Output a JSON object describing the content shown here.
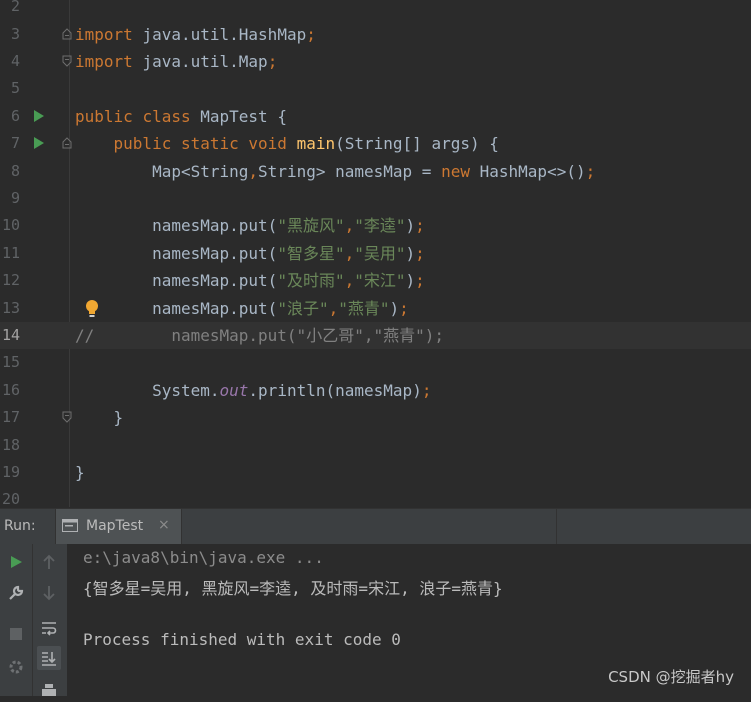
{
  "editor": {
    "lines": [
      {
        "num": "2",
        "code": ""
      },
      {
        "num": "3",
        "code": "import java.util.HashMap;"
      },
      {
        "num": "4",
        "code": "import java.util.Map;"
      },
      {
        "num": "5",
        "code": ""
      },
      {
        "num": "6",
        "code": "public class MapTest {"
      },
      {
        "num": "7",
        "code": "    public static void main(String[] args) {"
      },
      {
        "num": "8",
        "code": "        Map<String,String> namesMap = new HashMap<>();"
      },
      {
        "num": "9",
        "code": ""
      },
      {
        "num": "10",
        "code": "        namesMap.put(\"黑旋风\",\"李逵\");"
      },
      {
        "num": "11",
        "code": "        namesMap.put(\"智多星\",\"吴用\");"
      },
      {
        "num": "12",
        "code": "        namesMap.put(\"及时雨\",\"宋江\");"
      },
      {
        "num": "13",
        "code": "        namesMap.put(\"浪子\",\"燕青\");"
      },
      {
        "num": "14",
        "code": "//        namesMap.put(\"小乙哥\",\"燕青\");"
      },
      {
        "num": "15",
        "code": ""
      },
      {
        "num": "16",
        "code": "        System.out.println(namesMap);"
      },
      {
        "num": "17",
        "code": "    }"
      },
      {
        "num": "18",
        "code": ""
      },
      {
        "num": "19",
        "code": "}"
      },
      {
        "num": "20",
        "code": ""
      }
    ],
    "current_line": "14"
  },
  "run_panel": {
    "label": "Run:",
    "tab_title": "MapTest",
    "tab_close": "×",
    "console": [
      "e:\\java8\\bin\\java.exe ...",
      "{智多星=吴用, 黑旋风=李逵, 及时雨=宋江, 浪子=燕青}",
      "",
      "Process finished with exit code 0"
    ]
  },
  "watermark": "CSDN @挖掘者hy",
  "colors": {
    "background": "#2b2b2b",
    "keyword": "#cc7832",
    "string": "#6a8759",
    "function": "#ffc66d",
    "comment": "#808080",
    "field": "#9876aa",
    "run_green": "#499c54"
  }
}
